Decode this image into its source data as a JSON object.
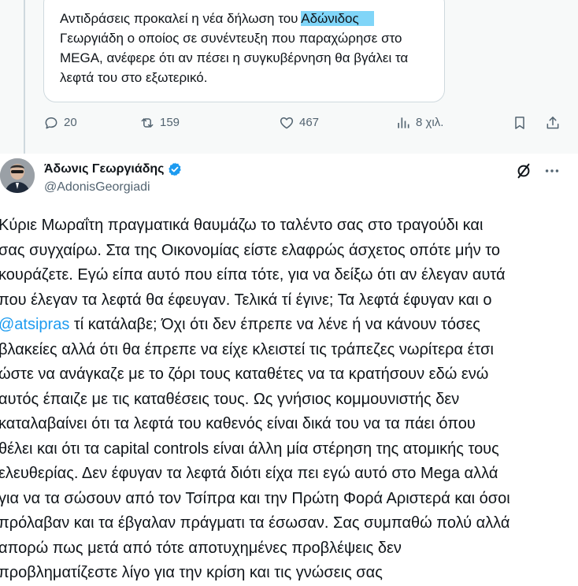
{
  "quoted_tweet": {
    "text_lines": [
      "Αντιδράσεις προκαλεί η νέα δήλωση του Αδώνιδος",
      "Γεωργιάδη ο οποίος σε συνέντευξη που παραχώρησε στο",
      "MEGA, ανέφερε ότι αν πέσει η συγκυβέρνηση θα βγάλει τα",
      "λεφτά του στο εξωτερικό."
    ],
    "highlighted_fragment": "Αδώνιδος"
  },
  "actions": {
    "replies": "20",
    "reposts": "159",
    "likes": "467",
    "views": "8 χιλ."
  },
  "tweet": {
    "author_name": "Άδωνις Γεωργιάδης",
    "handle": "@AdonisGeorgiadi",
    "text_lines": [
      "Κύριε Μωραΐτη πραγματικά θαυμάζω το ταλέντο σας στο τραγούδι και",
      "σας συγχαίρω. Στα της Οικονομίας είστε ελαφρώς άσχετος οπότε μήν το",
      "κουράζετε. Εγώ είπα αυτό που είπα τότε, για να δείξω ότι αν έλεγαν αυτά",
      "που έλεγαν τα λεφτά θα έφευγαν. Τελικά τί έγινε; Τα λεφτά έφυγαν και ο",
      "@atsipras",
      " τί κατάλαβε; Όχι ότι δεν έπρεπε να λένε ή να κάνουν τόσες",
      "βλακείες αλλά ότι θα έπρεπε να είχε κλειστεί τις τράπεζες νωρίτερα έτσι",
      "ώστε να ανάγκαζε με το ζόρι τους καταθέτες να τα κρατήσουν εδώ ενώ",
      "αυτός έπαιζε με τις καταθέσεις τους. Ως γνήσιος κομμουνιστής δεν",
      "καταλαβαίνει ότι τα λεφτά του καθενός είναι δικά του να τα πάει όπου",
      "θέλει και ότι τα capital controls είναι άλλη μία στέρηση της ατομικής τους",
      "ελευθερίας. Δεν έφυγαν τα λεφτά διότι είχα πει εγώ αυτό στο Mega αλλά",
      "για να τα σώσουν από τον Τσίπρα και την Πρώτη Φορά Αριστερά και όσοι",
      "πρόλαβαν και τα έβγαλαν πράγματι τα έσωσαν. Σας συμπαθώ πολύ αλλά",
      "απορώ πως μετά από τότε αποτυχημένες προβλέψεις δεν",
      "προβληματίζεστε λίγο για την κρίση και τις γνώσεις σας"
    ]
  },
  "colors": {
    "accent": "#1d9bf0",
    "highlight": "#80d5f8",
    "secondary_text": "#536471"
  },
  "icons": [
    "reply-icon",
    "repost-icon",
    "like-icon",
    "views-icon",
    "bookmark-icon",
    "share-icon",
    "verified-badge-icon",
    "grok-icon",
    "more-icon"
  ]
}
